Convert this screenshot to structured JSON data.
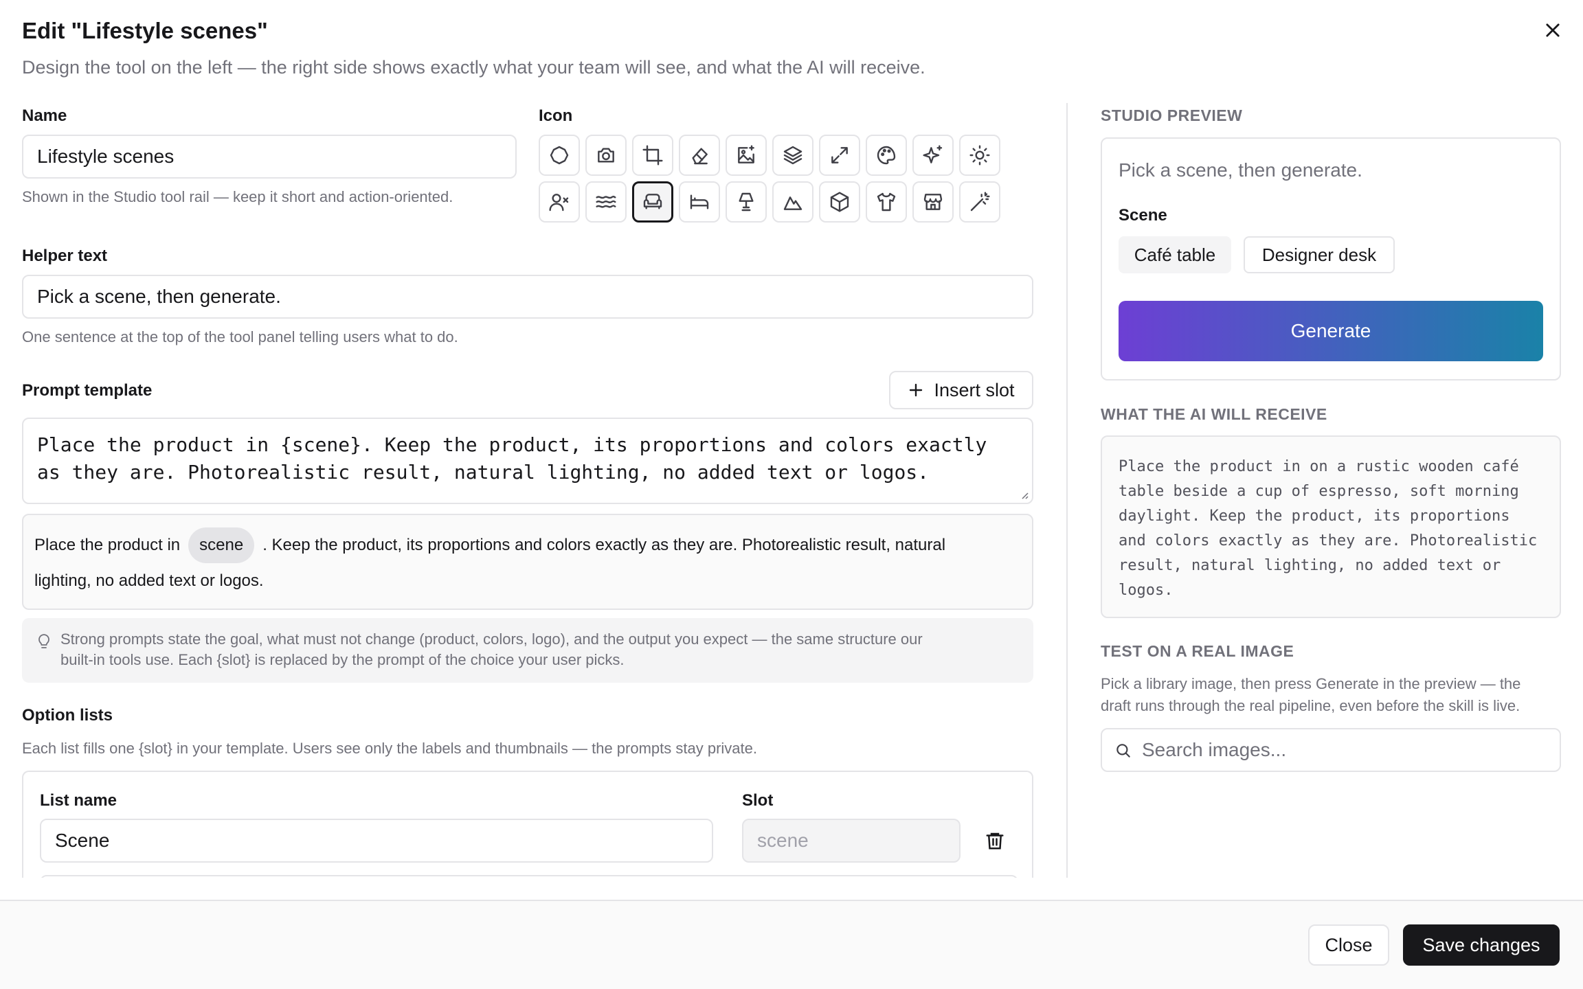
{
  "dialog": {
    "title": "Edit \"Lifestyle scenes\"",
    "subtitle": "Design the tool on the left — the right side shows exactly what your team will see, and what the AI will receive."
  },
  "name_field": {
    "label": "Name",
    "value": "Lifestyle scenes",
    "hint": "Shown in the Studio tool rail — keep it short and action-oriented."
  },
  "icon_picker": {
    "label": "Icon",
    "selected": "sofa-icon",
    "row1": [
      "circle-icon",
      "camera-icon",
      "crop-icon",
      "eraser-icon",
      "image-plus-icon",
      "layers-icon",
      "expand-icon",
      "palette-icon",
      "sparkles-icon",
      "sun-icon"
    ],
    "row2": [
      "user-x-icon",
      "waves-icon",
      "sofa-icon",
      "bed-icon",
      "lamp-icon",
      "mountain-icon",
      "box-icon",
      "shirt-icon",
      "store-icon",
      "wand-icon"
    ]
  },
  "helper_field": {
    "label": "Helper text",
    "value": "Pick a scene, then generate.",
    "hint": "One sentence at the top of the tool panel telling users what to do."
  },
  "prompt": {
    "label": "Prompt template",
    "insert_slot_label": "Insert slot",
    "template_line1": "Place the product in {scene}. Keep the product, its proportions and colors exactly",
    "template_line2": "as they are. Photorealistic result, natural lighting, no added text or logos.",
    "preview_before": "Place the product in",
    "preview_chip": "scene",
    "preview_after": ". Keep the product, its proportions and colors exactly as they are. Photorealistic result, natural",
    "preview_line2": "lighting, no added text or logos.",
    "tip": "Strong prompts state the goal, what must not change (product, colors, logo), and the output you expect — the same structure our",
    "tip_line2": "built-in tools use. Each {slot} is replaced by the prompt of the choice your user picks."
  },
  "options": {
    "label": "Option lists",
    "hint": "Each list fills one {slot} in your template. Users see only the labels and thumbnails — the prompts stay private.",
    "list_name_label": "List name",
    "slot_label": "Slot",
    "list_name_value": "Scene",
    "slot_value": "scene"
  },
  "preview": {
    "heading": "STUDIO PREVIEW",
    "helper": "Pick a scene, then generate.",
    "scene_label": "Scene",
    "chips": [
      "Café table",
      "Designer desk"
    ],
    "generate_label": "Generate",
    "gradient_start": "#6d3fd4",
    "gradient_end": "#1a82a8"
  },
  "ai_receive": {
    "heading": "WHAT THE AI WILL RECEIVE",
    "lines": [
      "Place the product in on a rustic wooden café",
      "table beside a cup of espresso, soft morning",
      "daylight. Keep the product, its proportions",
      "and colors exactly as they are. Photorealistic",
      "result, natural lighting, no added text or",
      "logos."
    ]
  },
  "test": {
    "heading": "TEST ON A REAL IMAGE",
    "hint_line1": "Pick a library image, then press Generate in the preview — the",
    "hint_line2": "draft runs through the real pipeline, even before the skill is live.",
    "search_placeholder": "Search images..."
  },
  "footer": {
    "close_label": "Close",
    "save_label": "Save changes"
  }
}
